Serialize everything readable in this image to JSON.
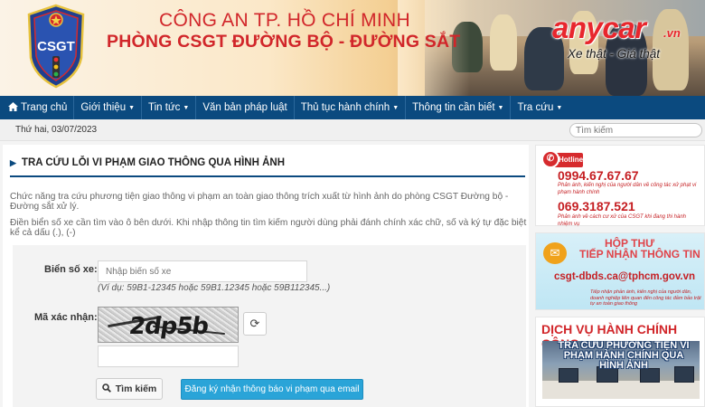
{
  "header": {
    "org_line1": "CÔNG AN TP. HỒ CHÍ MINH",
    "org_line2": "PHÒNG CSGT ĐƯỜNG BỘ - ĐƯỜNG SẮT",
    "logo_text": "CSGT",
    "watermark": {
      "brand": "anycar",
      "tld": ".vn",
      "slogan": "Xe thật - Giá thật"
    }
  },
  "nav": {
    "items": [
      {
        "label": "Trang chủ",
        "icon": "home-icon",
        "has_dropdown": false
      },
      {
        "label": "Giới thiệu",
        "has_dropdown": true
      },
      {
        "label": "Tin tức",
        "has_dropdown": true
      },
      {
        "label": "Văn bản pháp luật",
        "has_dropdown": false
      },
      {
        "label": "Thủ tục hành chính",
        "has_dropdown": true
      },
      {
        "label": "Thông tin cần biết",
        "has_dropdown": true
      },
      {
        "label": "Tra cứu",
        "has_dropdown": true
      }
    ]
  },
  "topbar": {
    "date": "Thứ hai, 03/07/2023",
    "search_placeholder": "Tìm kiếm"
  },
  "main": {
    "title": "TRA CỨU LỖI VI PHẠM GIAO THÔNG QUA HÌNH ẢNH",
    "desc1": "Chức năng tra cứu phương tiện giao thông vi phạm an toàn giao thông trích xuất từ hình ảnh do phòng CSGT Đường bộ - Đường sắt xử lý.",
    "desc2": "Điền biển số xe cần tìm vào ô bên dưới. Khi nhập thông tin tìm kiếm người dùng phải đánh chính xác chữ, số và ký tự đặc biệt kể cả dấu (.), (-)",
    "form": {
      "plate_label": "Biển số xe:",
      "plate_placeholder": "Nhập biển số xe",
      "plate_hint": "(Ví dụ: 59B1-12345 hoặc 59B1.12345 hoặc 59B112345...)",
      "captcha_label": "Mã xác nhận:",
      "captcha_text": "2dp5b",
      "captcha_value": "",
      "search_button": "Tìm kiếm",
      "email_button": "Đăng ký nhận thông báo vi phạm qua email"
    }
  },
  "sidebar": {
    "hotline": {
      "badge": "Hotline",
      "number1": "0994.67.67.67",
      "sub1": "Phản ánh, kiến nghị của người dân về công tác xử phạt vi phạm hành chính",
      "number2": "069.3187.521",
      "sub2": "Phản ánh về cách cư xử của CSGT khi đang thi hành nhiệm vụ"
    },
    "mailbox": {
      "title1": "HỘP THƯ",
      "title2": "TIẾP NHẬN THÔNG TIN",
      "email": "csgt-dbds.ca@tphcm.gov.vn",
      "sub": "Tiếp nhận phản ánh, kiến nghị của người dân, doanh nghiệp liên quan đến công tác đảm bảo trật tự an toàn giao thông"
    },
    "services": {
      "title": "DỊCH VỤ HÀNH CHÍNH CÔNG",
      "banner_caption": "TRA CỨU PHƯƠNG TIỆN VI PHẠM HÀNH CHÍNH QUA HÌNH ẢNH"
    }
  },
  "colors": {
    "nav_bg": "#0b4a7f",
    "accent_red": "#d1262a",
    "email_button_bg": "#2aa4d8"
  }
}
